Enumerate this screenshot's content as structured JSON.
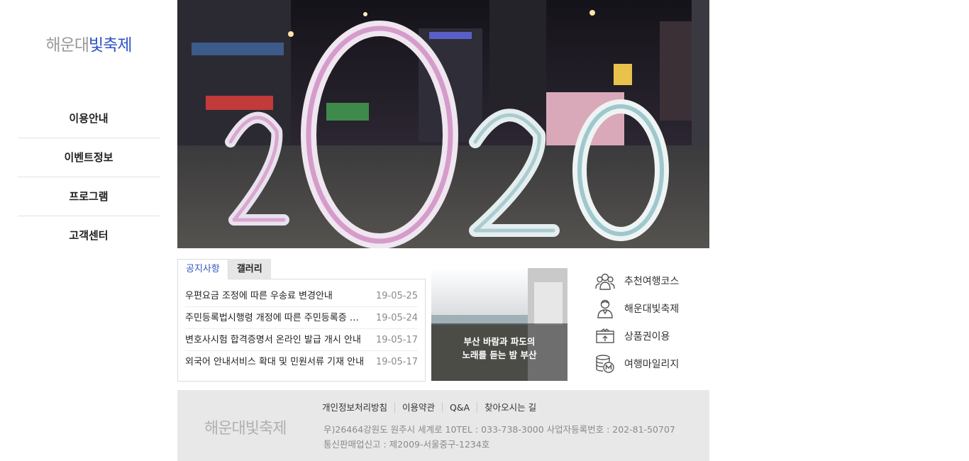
{
  "site": {
    "logo_part1": "해운대",
    "logo_part2": "빛축제"
  },
  "nav": {
    "items": [
      {
        "label": "이용안내"
      },
      {
        "label": "이벤트정보"
      },
      {
        "label": "프로그램"
      },
      {
        "label": "고객센터"
      }
    ]
  },
  "board": {
    "tabs": [
      {
        "label": "공지사항",
        "active": true
      },
      {
        "label": "갤러리",
        "active": false
      }
    ],
    "notices": [
      {
        "title": "우편요금 조정에 따른 우송료 변경안내",
        "date": "19-05-25"
      },
      {
        "title": "주민등록법시행령 개정에 따른 주민등록증 발급 안내",
        "date": "19-05-24"
      },
      {
        "title": "변호사시험 합격증명서 온라인 발급 개시 안내",
        "date": "19-05-17"
      },
      {
        "title": "외국어 안내서비스 확대 및 민원서류 기재 안내",
        "date": "19-05-17"
      }
    ]
  },
  "promo": {
    "line1": "부산 바람과 파도의",
    "line2": "노래를 듣는 밤 부산"
  },
  "quick_links": [
    {
      "label": "추천여행코스",
      "icon": "people-group-icon"
    },
    {
      "label": "해운대빛축제",
      "icon": "person-icon"
    },
    {
      "label": "상품권이용",
      "icon": "gift-voucher-icon"
    },
    {
      "label": "여행마일리지",
      "icon": "coin-stack-icon"
    }
  ],
  "footer": {
    "logo": "해운대빛축제",
    "links": [
      "개인정보처리방침",
      "이용약관",
      "Q&A",
      "찾아오시는 길"
    ],
    "address_line1": "우)26464강원도 원주시 세계로 10TEL : 033-738-3000 사업자등록번호 : 202-81-50707",
    "address_line2": "통신판매업신고 : 제2009-서울중구-1234호"
  },
  "colors": {
    "accent": "#2f55c7",
    "logo_gray": "#9a9a9a",
    "footer_bg": "#e8e8e8"
  }
}
